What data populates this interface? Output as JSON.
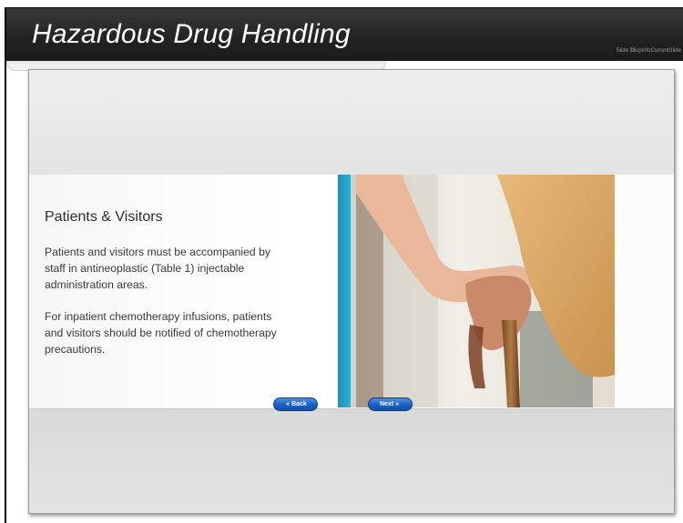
{
  "header": {
    "title": "Hazardous Drug Handling",
    "slide_info": "Slide $$cpInfoCurrentSlide"
  },
  "content": {
    "heading": "Patients & Visitors",
    "paragraphs": [
      "Patients and visitors must be accompanied by staff in antineoplastic (Table 1) injectable administration areas.",
      "For inpatient chemotherapy infusions, patients and visitors should be notified of chemotherapy precautions."
    ],
    "image": "photo-caregiver-hand-on-elderly-hand-with-cane"
  },
  "navigation": {
    "back_label": "Back",
    "back_icon": "double-left-arrow-icon",
    "next_label": "Next",
    "next_icon": "double-right-arrow-icon"
  },
  "colors": {
    "header_bg": "#222222",
    "button_blue": "#1c5ec4",
    "panel_bg": "#e6e6e6"
  }
}
